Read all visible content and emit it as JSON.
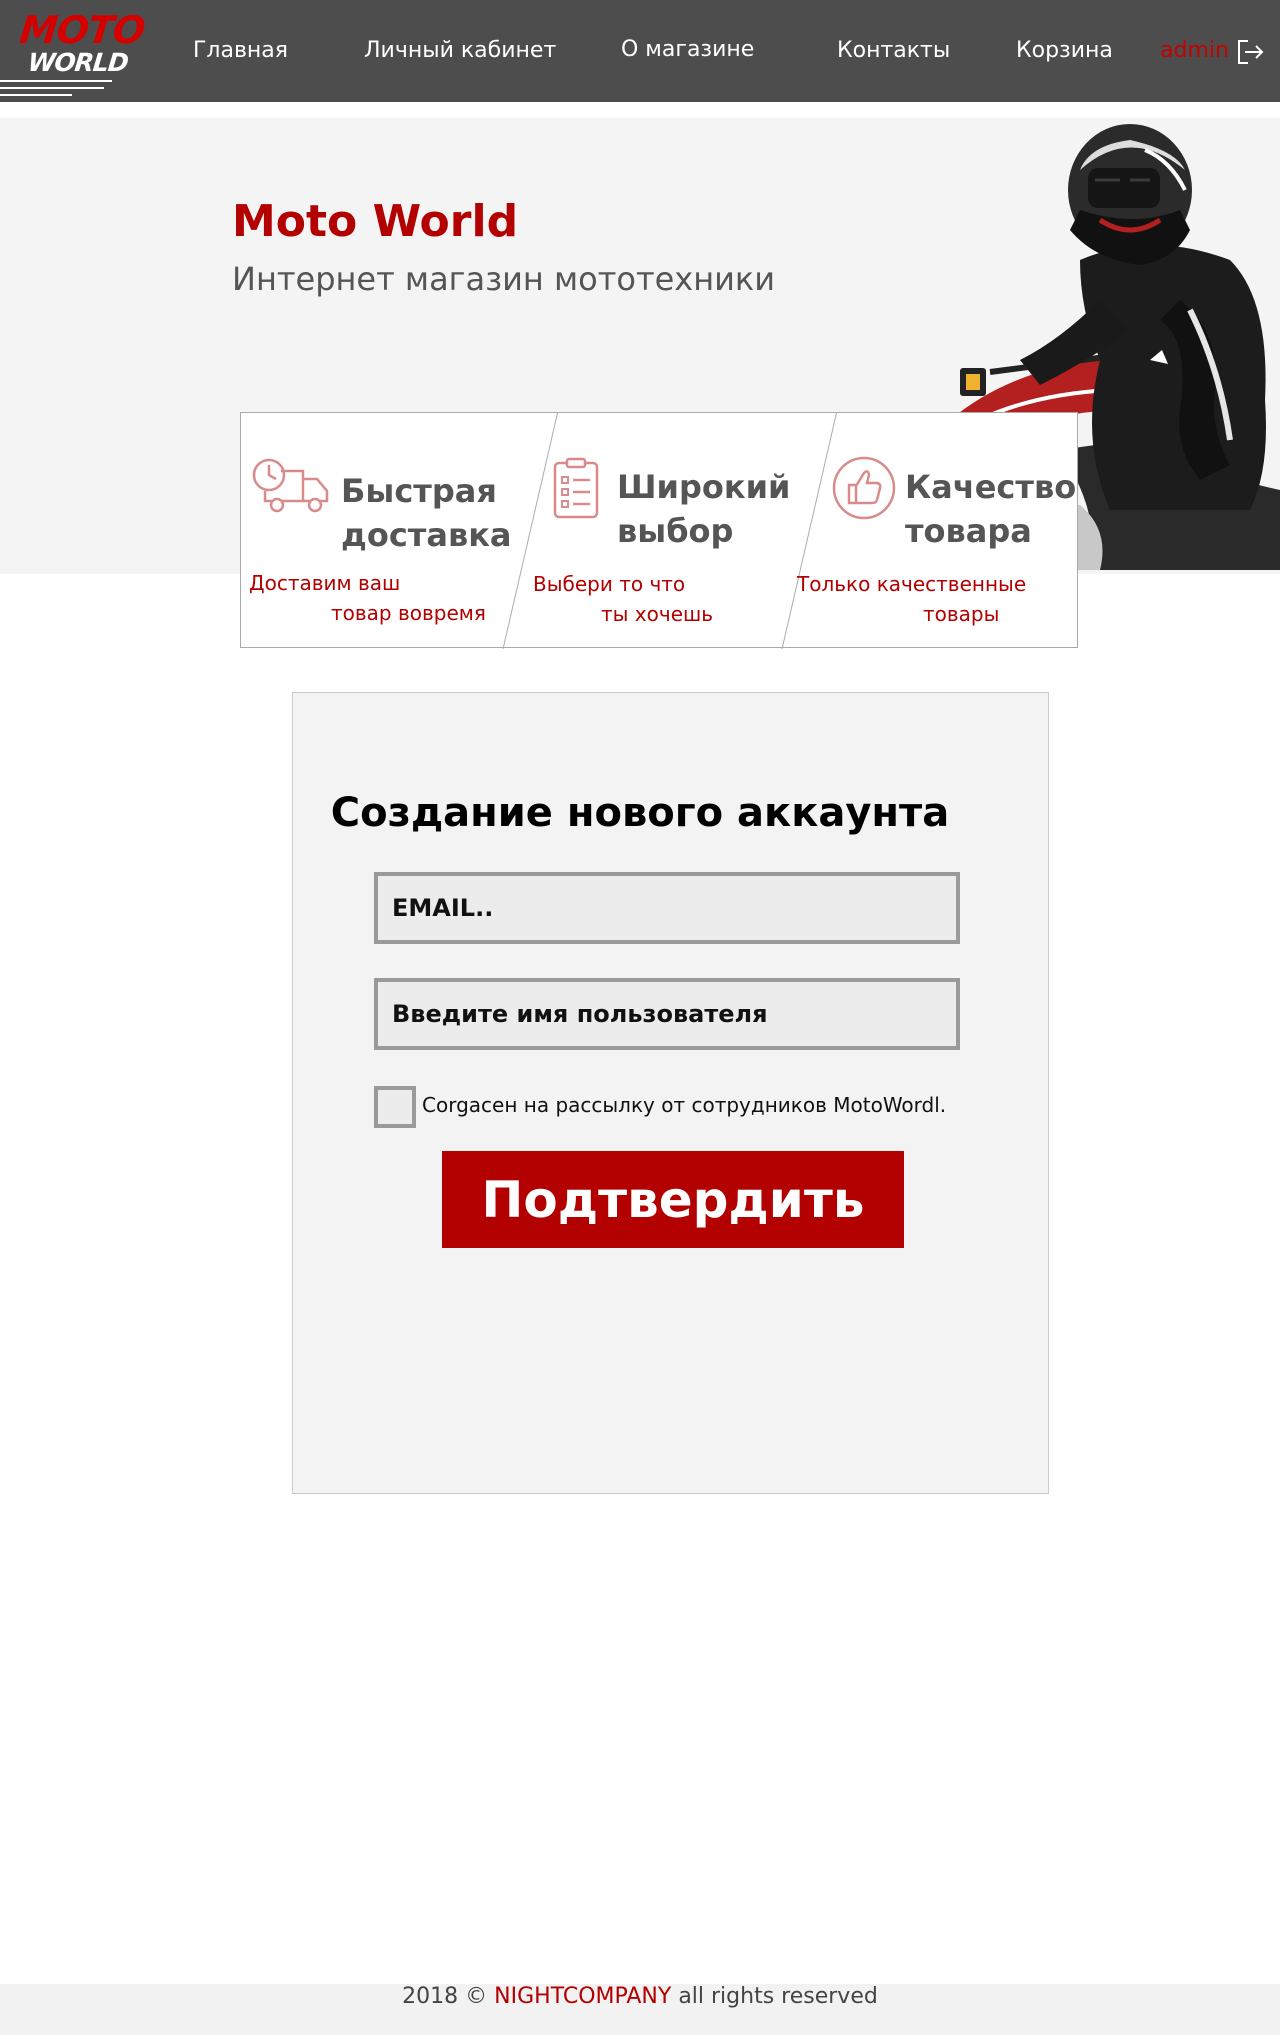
{
  "logo": {
    "line1": "MOTO",
    "line2": "WORLD"
  },
  "nav": {
    "items": [
      "Главная",
      "Личный кабинет",
      "О магазине",
      "Контакты",
      "Корзина"
    ],
    "user": "admin"
  },
  "hero": {
    "title": "Moto World",
    "subtitle": "Интернет магазин мототехники"
  },
  "features": [
    {
      "icon": "delivery-truck-icon",
      "title_lines": [
        "Быстрая",
        "доставка"
      ],
      "desc_lines": [
        "Доставим ваш",
        "товар вовремя"
      ]
    },
    {
      "icon": "checklist-icon",
      "title_lines": [
        "Широкий",
        "выбор"
      ],
      "desc_lines": [
        "Выбери то что",
        "ты хочешь"
      ]
    },
    {
      "icon": "thumbs-up-icon",
      "title_lines": [
        "Качество",
        "товара"
      ],
      "desc_lines": [
        "Только качественные",
        "товары"
      ]
    }
  ],
  "form": {
    "title": "Создание нового аккаунта",
    "email_placeholder": "EMAIL..",
    "username_placeholder": "Введите имя пользователя",
    "checkbox_label": "Corgaсен на рассылку от сотрудников MotoWordl.",
    "submit_label": "Подтвердить"
  },
  "footer": {
    "year": "2018 ©",
    "brand": "NIGHTCOMPANY",
    "rest": "all rights reserved"
  },
  "colors": {
    "accent": "#b30000",
    "nav_bg": "#4d4d4d",
    "hero_bg": "#f4f4f4"
  }
}
